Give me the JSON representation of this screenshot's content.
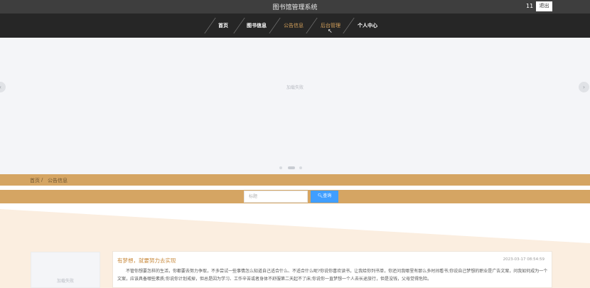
{
  "header": {
    "title": "图书馆管理系统",
    "user": "11",
    "logout_label": "退出"
  },
  "nav": {
    "items": [
      {
        "label": "首页",
        "active": false
      },
      {
        "label": "图书信息",
        "active": false
      },
      {
        "label": "公告信息",
        "active": true
      },
      {
        "label": "后台管理",
        "active": true
      },
      {
        "label": "个人中心",
        "active": false
      }
    ]
  },
  "banner": {
    "placeholder": "加载失败",
    "prev_icon": "chevron-left-icon",
    "next_icon": "chevron-right-icon",
    "slide_count": 3,
    "active_slide": 2
  },
  "breadcrumb": {
    "home": "首页",
    "separator": "/",
    "current": "公告信息"
  },
  "search": {
    "placeholder": "标题",
    "value": "",
    "button_label": "查询",
    "button_icon": "search-icon"
  },
  "list": {
    "thumb_placeholder": "加载失败",
    "items": [
      {
        "title": "有梦想，就要努力去实现",
        "date": "2023-03-17 08:54:59",
        "body": "不管你想要怎样的生活，你都要去努力争取，不多尝试一些事情怎么知道自己适合什么、不适合什么呢?你说你喜欢读书，让我给你列书单，你还问我哪里有那么多时间看书;你说自己梦想的职业是广告文案，问我如何成为一个文案，应该具备哪些素质;你说你计划戒掉，但总是因为学习、工作辛苦或者身体不舒服第二天起不了床;你说你一直梦想一个人去长途旅行，但是没钱，父母觉得危险。"
      }
    ]
  },
  "colors": {
    "topbar": "#3e3e3e",
    "nav": "#262626",
    "accent": "#d5a563",
    "active_text": "#d4a05a",
    "search_button": "#409eff",
    "content_bg": "#fbeee0",
    "title_text": "#c8893b"
  }
}
